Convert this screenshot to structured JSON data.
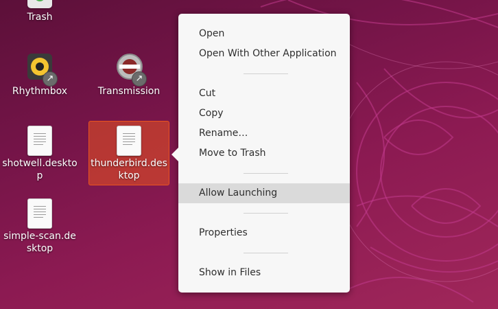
{
  "desktop": {
    "icons": [
      {
        "label": "Trash",
        "icon": "trash-icon"
      },
      {
        "label": "Rhythmbox",
        "icon": "rhythmbox-icon"
      },
      {
        "label": "Transmission",
        "icon": "transmission-icon"
      },
      {
        "label": "shotwell.desktop",
        "icon": "text-file-icon"
      },
      {
        "label": "thunderbird.desktop",
        "icon": "text-file-icon"
      },
      {
        "label": "simple-scan.desktop",
        "icon": "text-file-icon"
      }
    ],
    "accent_color": "#e95420",
    "shortcut_badge_glyph": "↗"
  },
  "context_menu": {
    "items": [
      {
        "label": "Open"
      },
      {
        "label": "Open With Other Application"
      },
      {
        "label": "Cut"
      },
      {
        "label": "Copy"
      },
      {
        "label": "Rename…"
      },
      {
        "label": "Move to Trash"
      },
      {
        "label": "Allow Launching",
        "highlighted": true
      },
      {
        "label": "Properties"
      },
      {
        "label": "Show in Files"
      }
    ]
  }
}
